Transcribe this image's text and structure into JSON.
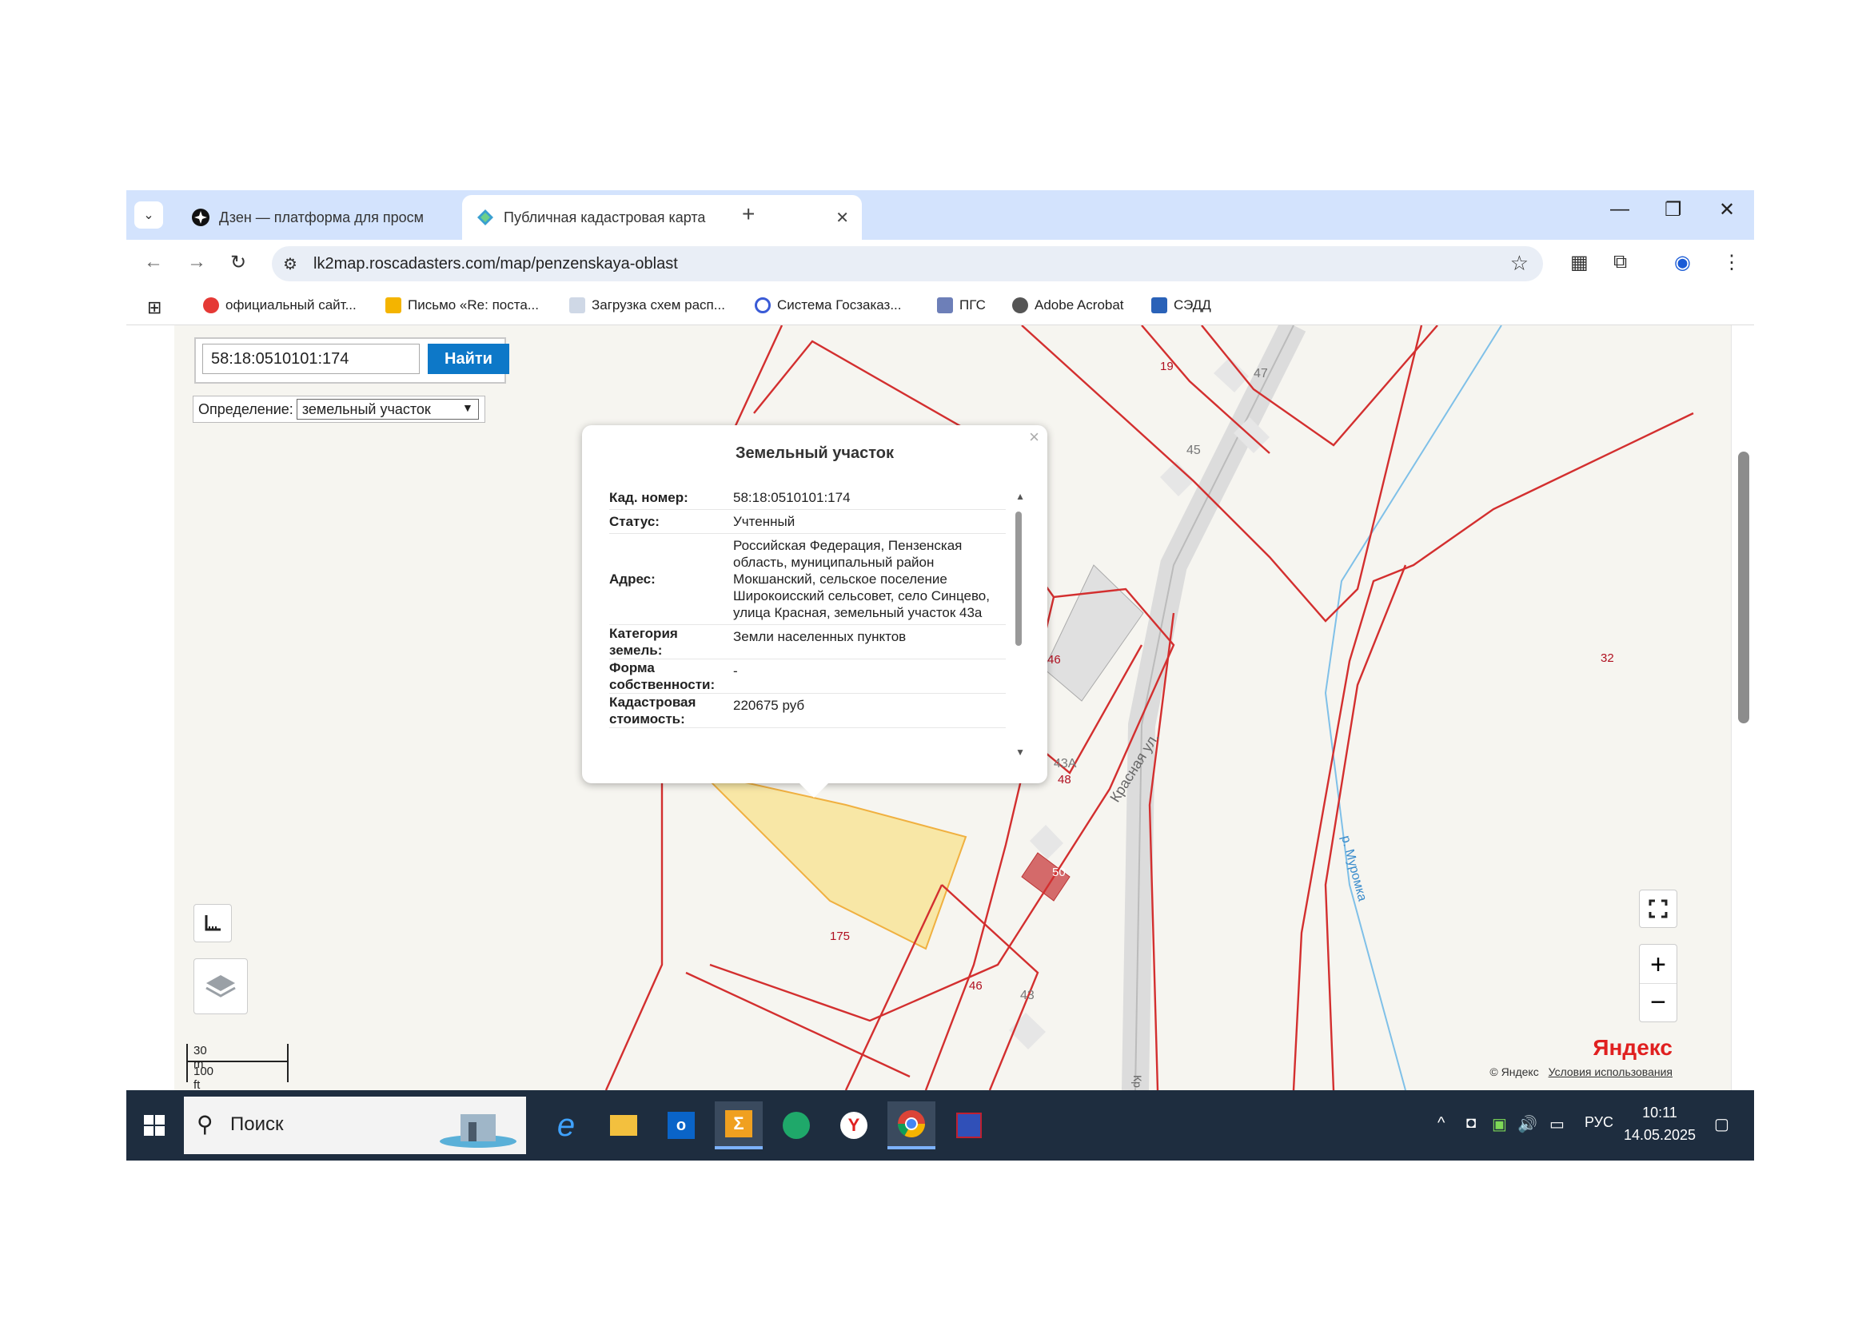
{
  "browser": {
    "tabs": [
      {
        "title": "Дзен — платформа для просм",
        "active": false
      },
      {
        "title": "Публичная кадастровая карта",
        "active": true
      }
    ],
    "url": "lk2map.roscadasters.com/map/penzenskaya-oblast",
    "bookmarks": [
      "официальный сайт...",
      "Письмо «Re: поста...",
      "Загрузка схем расп...",
      "Система Госзаказ...",
      "ПГС",
      "Adobe Acrobat",
      "СЭДД"
    ]
  },
  "map": {
    "search": {
      "value": "58:18:0510101:174",
      "button": "Найти"
    },
    "definition": {
      "label": "Определение:",
      "selected": "земельный участок"
    },
    "popup": {
      "title": "Земельный участок",
      "rows": [
        {
          "key": "Кад. номер:",
          "value": "58:18:0510101:174"
        },
        {
          "key": "Статус:",
          "value": "Учтенный"
        },
        {
          "key": "Адрес:",
          "value": "Российская Федерация, Пензенская область, муниципальный район Мокшанский, сельское поселение Широкоисский сельсовет, село Синцево, улица Красная, земельный участок 43а"
        },
        {
          "key": "Категория земель:",
          "value": "Земли населенных пунктов"
        },
        {
          "key": "Форма собственности:",
          "value": "-"
        },
        {
          "key": "Кадастровая стоимость:",
          "value": "220675 руб"
        }
      ]
    },
    "labels": {
      "parcels": [
        "19",
        "46",
        "32",
        "48",
        "175",
        "46",
        "50"
      ],
      "buildings": [
        "47",
        "45",
        "43А",
        "43"
      ],
      "street": "Красная ул.",
      "street_short": "Кр",
      "river": "р. Муромка"
    },
    "scale": {
      "metric": "30 m",
      "imperial": "100 ft"
    },
    "attribution": {
      "brand": "Яндекс",
      "copyright": "© Яндекс",
      "terms": "Условия использования"
    }
  },
  "taskbar": {
    "search_placeholder": "Поиск",
    "lang": "РУС",
    "time": "10:11",
    "date": "14.05.2025"
  }
}
